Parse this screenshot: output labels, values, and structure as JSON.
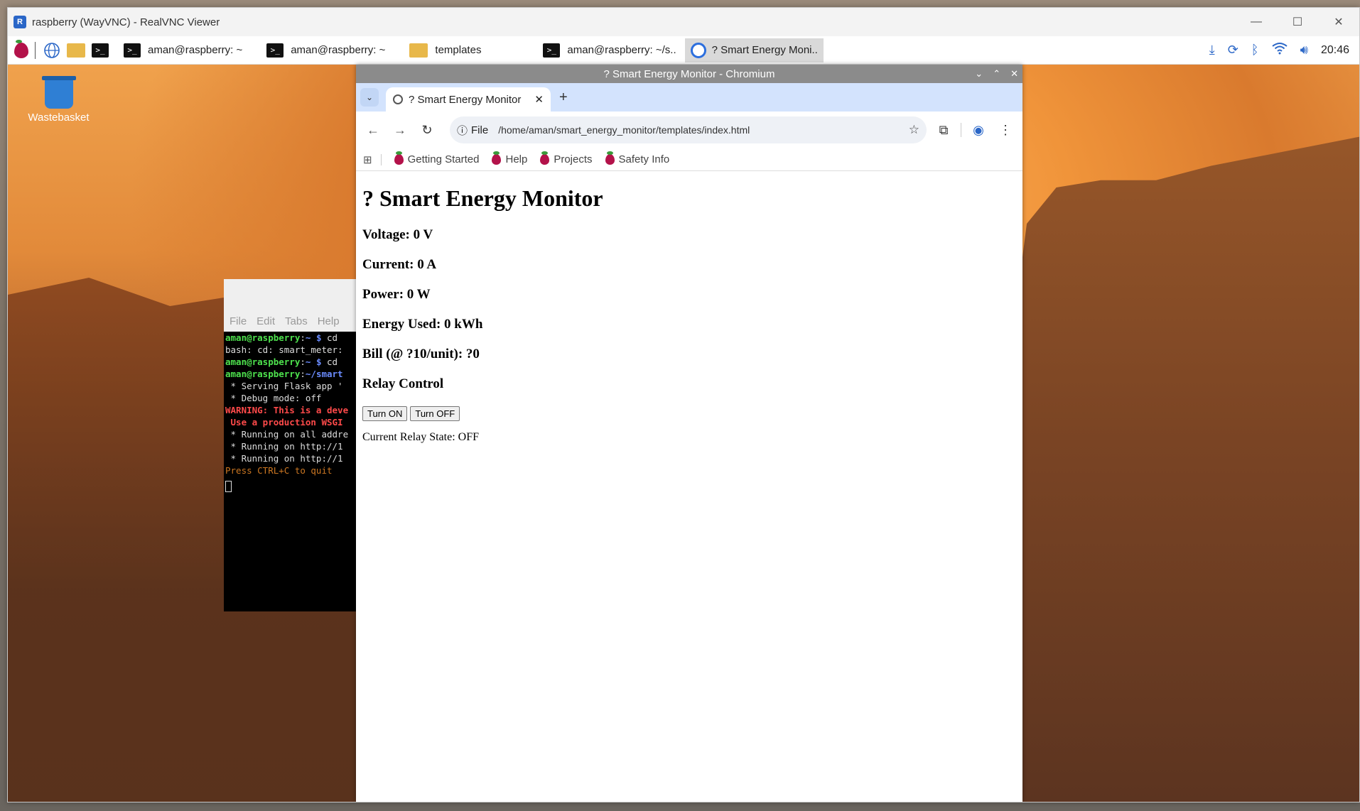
{
  "vnc": {
    "title": "raspberry (WayVNC) - RealVNC Viewer",
    "logo": "R",
    "minimize": "—",
    "maximize": "☐",
    "close": "✕"
  },
  "taskbar": {
    "tasks": [
      {
        "label": "aman@raspberry: ~",
        "icon": "terminal-icon"
      },
      {
        "label": "aman@raspberry: ~",
        "icon": "terminal-icon"
      },
      {
        "label": "templates",
        "icon": "folder-icon"
      },
      {
        "label": "aman@raspberry: ~/s..",
        "icon": "terminal-icon"
      },
      {
        "label": "? Smart Energy Moni..",
        "icon": "chromium-icon"
      }
    ],
    "clock": "20:46"
  },
  "desktop": {
    "wastebasket_label": "Wastebasket"
  },
  "terminal": {
    "menu": [
      "File",
      "Edit",
      "Tabs",
      "Help"
    ]
  },
  "chromium": {
    "window_title": "? Smart Energy Monitor - Chromium",
    "tab_title": "? Smart Energy Monitor",
    "omnibox_chip": "File",
    "url": "/home/aman/smart_energy_monitor/templates/index.html",
    "bookmarks": [
      "Getting Started",
      "Help",
      "Projects",
      "Safety Info"
    ]
  },
  "page": {
    "heading": "? Smart Energy Monitor",
    "voltage": "Voltage: 0 V",
    "current": "Current: 0 A",
    "power": "Power: 0 W",
    "energy": "Energy Used: 0 kWh",
    "bill": "Bill (@ ?10/unit): ?0",
    "relay_heading": "Relay Control",
    "turn_on": "Turn ON",
    "turn_off": "Turn OFF",
    "relay_state": "Current Relay State: OFF"
  },
  "colors": {
    "accent": "#2a66c7",
    "chrome_tabbar": "#d3e3fd"
  }
}
